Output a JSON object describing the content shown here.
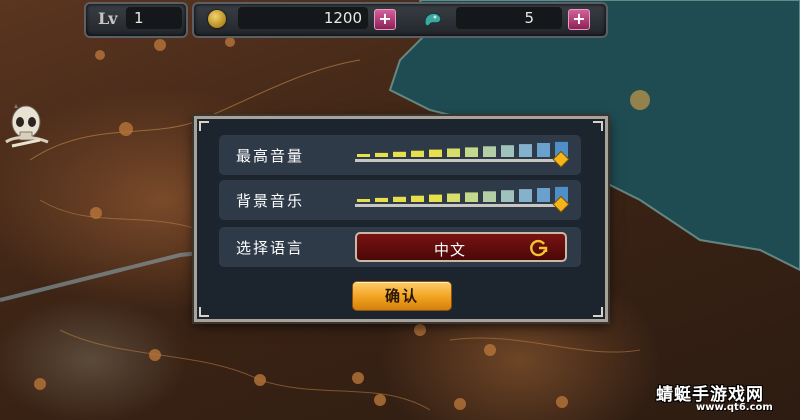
{
  "hud": {
    "level_label": "Lv",
    "level_value": "1",
    "gold_value": "1200",
    "gem_value": "5",
    "plus_symbol": "+"
  },
  "settings": {
    "volume_label": "最高音量",
    "bgm_label": "背景音乐",
    "language_label": "选择语言",
    "language_value": "中文",
    "volume_level": 1.0,
    "bgm_level": 1.0,
    "confirm_label": "确认"
  },
  "watermark": {
    "title": "蜻蜓手游戏网",
    "url": "www.qt6.com"
  },
  "colors": {
    "sea": "#1f4b52",
    "dialog_bg": "#1c242d",
    "row_bg": "#2f3a48",
    "slider_yellow": "#e8e04a",
    "slider_blue": "#4f8fc8",
    "knob": "#f4b41a",
    "language_select": "#6a0e0e",
    "confirm_button": "#f0a21f",
    "plus_button": "#c0407e"
  },
  "icons": {
    "coin": "coin-icon",
    "gem": "gem-icon",
    "refresh": "refresh-icon",
    "skull": "skull-character-icon"
  }
}
